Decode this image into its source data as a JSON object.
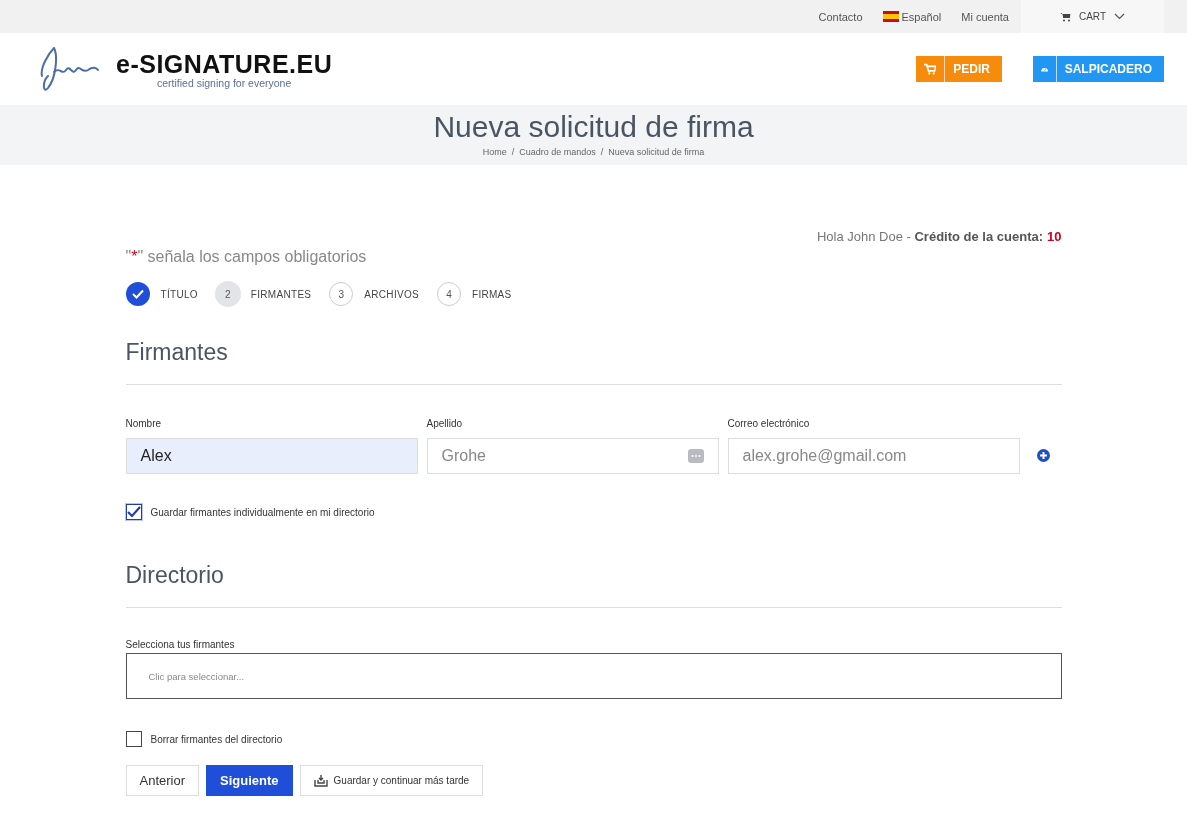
{
  "top_bar": {
    "links": [
      "Contacto",
      "Español",
      "Mi cuenta"
    ],
    "cart": "CART"
  },
  "header": {
    "logo": "e-SIGNATURE.EU",
    "tagline": "certified signing for everyone",
    "buttons": [
      {
        "label": "PEDIR",
        "kind": "order"
      },
      {
        "label": "SALPICADERO",
        "kind": "dashboard"
      }
    ]
  },
  "page_title": "Nueva solicitud de firma",
  "breadcrumb": [
    "Home",
    "Cuadro de mandos",
    "Nueva solicitud de firma"
  ],
  "breadcrumb_separator": "/",
  "greeting": "Hola John Doe - **Crédito de la cuenta:**",
  "credit": "10",
  "required_note": {
    "open": "\"",
    "mark": "*",
    "close": "\" señala los campos obligatorios"
  },
  "steps": [
    {
      "label": "TÍTULO",
      "completed": true,
      "selected": false
    },
    {
      "number": "2",
      "label": "FIRMANTES",
      "completed": false,
      "selected": true
    },
    {
      "number": "3",
      "label": "ARCHIVOS",
      "completed": false,
      "selected": false
    },
    {
      "number": "4",
      "label": "FIRMAS",
      "completed": false,
      "selected": false
    }
  ],
  "signers_section": {
    "title": "Firmantes",
    "fields": [
      {
        "label": "Nombre",
        "value": "Alex",
        "kind": "filled"
      },
      {
        "label": "Apellido",
        "placeholder": "Grohe",
        "kind": "menu"
      },
      {
        "label": "Correo electrónico",
        "placeholder": "alex.grohe@gmail.com",
        "kind": "plain"
      }
    ],
    "save_checkbox": {
      "label": "Guardar firmantes individualmente en mi directorio",
      "checked": true
    }
  },
  "directory_section": {
    "title": "Directorio",
    "select_label": "Selecciona tus firmantes",
    "select_placeholder": "Clic para seleccionar...",
    "delete_checkbox": {
      "label": "Borrar firmantes del directorio",
      "checked": false
    }
  },
  "buttons": [
    {
      "label": "Anterior",
      "kind": "secondary"
    },
    {
      "label": "Siguiente",
      "kind": "primary"
    },
    {
      "label": "Guardar y continuar más tarde",
      "kind": "save"
    }
  ]
}
